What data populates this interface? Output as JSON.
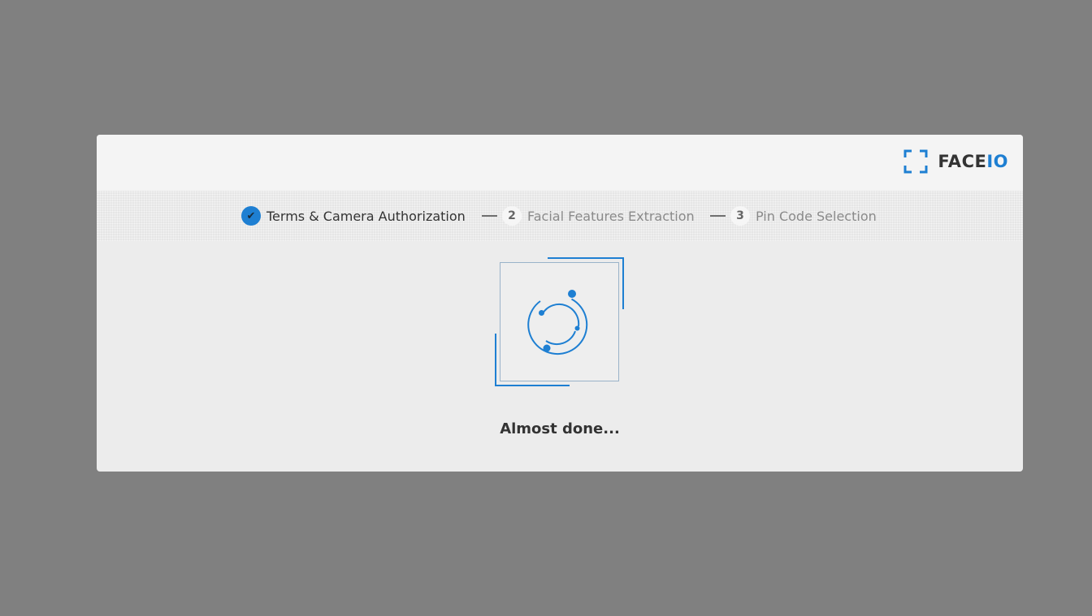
{
  "brand": {
    "name_prefix": "FACE",
    "name_suffix": "IO",
    "accent_color": "#1e7fd2"
  },
  "steps": [
    {
      "marker": "✔",
      "label": "Terms & Camera Authorization",
      "state": "done"
    },
    {
      "marker": "2",
      "label": "Facial Features Extraction",
      "state": "pending"
    },
    {
      "marker": "3",
      "label": "Pin Code Selection",
      "state": "pending"
    }
  ],
  "status": {
    "message": "Almost done..."
  },
  "icons": {
    "brand": "face-scan-frame-icon",
    "loader": "orbit-spinner-icon",
    "done": "checkmark-icon"
  }
}
